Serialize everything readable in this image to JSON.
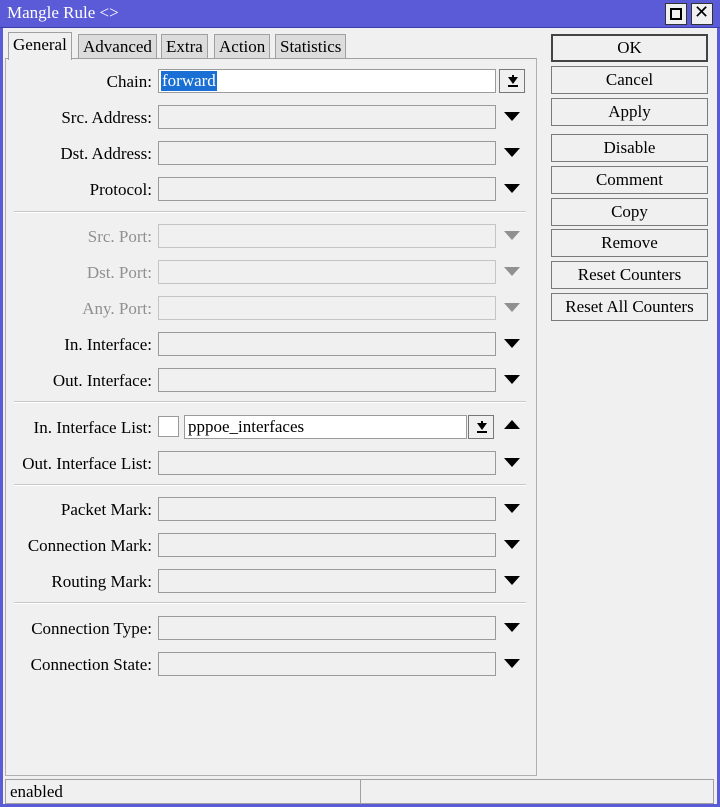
{
  "window": {
    "title": "Mangle Rule <>"
  },
  "tabs": [
    "General",
    "Advanced",
    "Extra",
    "Action",
    "Statistics"
  ],
  "fields": {
    "chain": {
      "label": "Chain:",
      "value": "forward"
    },
    "src_address": {
      "label": "Src. Address:"
    },
    "dst_address": {
      "label": "Dst. Address:"
    },
    "protocol": {
      "label": "Protocol:"
    },
    "src_port": {
      "label": "Src. Port:"
    },
    "dst_port": {
      "label": "Dst. Port:"
    },
    "any_port": {
      "label": "Any. Port:"
    },
    "in_interface": {
      "label": "In. Interface:"
    },
    "out_interface": {
      "label": "Out. Interface:"
    },
    "in_interface_list": {
      "label": "In. Interface List:",
      "value": "pppoe_interfaces"
    },
    "out_interface_list": {
      "label": "Out. Interface List:"
    },
    "packet_mark": {
      "label": "Packet Mark:"
    },
    "connection_mark": {
      "label": "Connection Mark:"
    },
    "routing_mark": {
      "label": "Routing Mark:"
    },
    "connection_type": {
      "label": "Connection Type:"
    },
    "connection_state": {
      "label": "Connection State:"
    }
  },
  "buttons": {
    "ok": "OK",
    "cancel": "Cancel",
    "apply": "Apply",
    "disable": "Disable",
    "comment": "Comment",
    "copy": "Copy",
    "remove": "Remove",
    "reset_counters": "Reset Counters",
    "reset_all_counters": "Reset All Counters"
  },
  "status": {
    "left": "enabled"
  },
  "colors": {
    "titlebar": "#5b5bd8",
    "selection": "#1a6fd4"
  }
}
